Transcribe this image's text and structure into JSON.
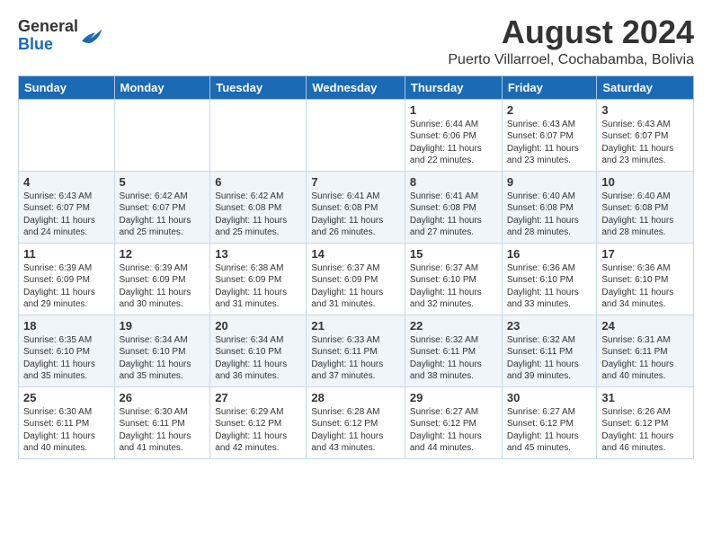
{
  "logo": {
    "general": "General",
    "blue": "Blue"
  },
  "title": "August 2024",
  "subtitle": "Puerto Villarroel, Cochabamba, Bolivia",
  "days_header": [
    "Sunday",
    "Monday",
    "Tuesday",
    "Wednesday",
    "Thursday",
    "Friday",
    "Saturday"
  ],
  "weeks": [
    [
      {
        "day": "",
        "info": ""
      },
      {
        "day": "",
        "info": ""
      },
      {
        "day": "",
        "info": ""
      },
      {
        "day": "",
        "info": ""
      },
      {
        "day": "1",
        "info": "Sunrise: 6:44 AM\nSunset: 6:06 PM\nDaylight: 11 hours\nand 22 minutes."
      },
      {
        "day": "2",
        "info": "Sunrise: 6:43 AM\nSunset: 6:07 PM\nDaylight: 11 hours\nand 23 minutes."
      },
      {
        "day": "3",
        "info": "Sunrise: 6:43 AM\nSunset: 6:07 PM\nDaylight: 11 hours\nand 23 minutes."
      }
    ],
    [
      {
        "day": "4",
        "info": "Sunrise: 6:43 AM\nSunset: 6:07 PM\nDaylight: 11 hours\nand 24 minutes."
      },
      {
        "day": "5",
        "info": "Sunrise: 6:42 AM\nSunset: 6:07 PM\nDaylight: 11 hours\nand 25 minutes."
      },
      {
        "day": "6",
        "info": "Sunrise: 6:42 AM\nSunset: 6:08 PM\nDaylight: 11 hours\nand 25 minutes."
      },
      {
        "day": "7",
        "info": "Sunrise: 6:41 AM\nSunset: 6:08 PM\nDaylight: 11 hours\nand 26 minutes."
      },
      {
        "day": "8",
        "info": "Sunrise: 6:41 AM\nSunset: 6:08 PM\nDaylight: 11 hours\nand 27 minutes."
      },
      {
        "day": "9",
        "info": "Sunrise: 6:40 AM\nSunset: 6:08 PM\nDaylight: 11 hours\nand 28 minutes."
      },
      {
        "day": "10",
        "info": "Sunrise: 6:40 AM\nSunset: 6:08 PM\nDaylight: 11 hours\nand 28 minutes."
      }
    ],
    [
      {
        "day": "11",
        "info": "Sunrise: 6:39 AM\nSunset: 6:09 PM\nDaylight: 11 hours\nand 29 minutes."
      },
      {
        "day": "12",
        "info": "Sunrise: 6:39 AM\nSunset: 6:09 PM\nDaylight: 11 hours\nand 30 minutes."
      },
      {
        "day": "13",
        "info": "Sunrise: 6:38 AM\nSunset: 6:09 PM\nDaylight: 11 hours\nand 31 minutes."
      },
      {
        "day": "14",
        "info": "Sunrise: 6:37 AM\nSunset: 6:09 PM\nDaylight: 11 hours\nand 31 minutes."
      },
      {
        "day": "15",
        "info": "Sunrise: 6:37 AM\nSunset: 6:10 PM\nDaylight: 11 hours\nand 32 minutes."
      },
      {
        "day": "16",
        "info": "Sunrise: 6:36 AM\nSunset: 6:10 PM\nDaylight: 11 hours\nand 33 minutes."
      },
      {
        "day": "17",
        "info": "Sunrise: 6:36 AM\nSunset: 6:10 PM\nDaylight: 11 hours\nand 34 minutes."
      }
    ],
    [
      {
        "day": "18",
        "info": "Sunrise: 6:35 AM\nSunset: 6:10 PM\nDaylight: 11 hours\nand 35 minutes."
      },
      {
        "day": "19",
        "info": "Sunrise: 6:34 AM\nSunset: 6:10 PM\nDaylight: 11 hours\nand 35 minutes."
      },
      {
        "day": "20",
        "info": "Sunrise: 6:34 AM\nSunset: 6:10 PM\nDaylight: 11 hours\nand 36 minutes."
      },
      {
        "day": "21",
        "info": "Sunrise: 6:33 AM\nSunset: 6:11 PM\nDaylight: 11 hours\nand 37 minutes."
      },
      {
        "day": "22",
        "info": "Sunrise: 6:32 AM\nSunset: 6:11 PM\nDaylight: 11 hours\nand 38 minutes."
      },
      {
        "day": "23",
        "info": "Sunrise: 6:32 AM\nSunset: 6:11 PM\nDaylight: 11 hours\nand 39 minutes."
      },
      {
        "day": "24",
        "info": "Sunrise: 6:31 AM\nSunset: 6:11 PM\nDaylight: 11 hours\nand 40 minutes."
      }
    ],
    [
      {
        "day": "25",
        "info": "Sunrise: 6:30 AM\nSunset: 6:11 PM\nDaylight: 11 hours\nand 40 minutes."
      },
      {
        "day": "26",
        "info": "Sunrise: 6:30 AM\nSunset: 6:11 PM\nDaylight: 11 hours\nand 41 minutes."
      },
      {
        "day": "27",
        "info": "Sunrise: 6:29 AM\nSunset: 6:12 PM\nDaylight: 11 hours\nand 42 minutes."
      },
      {
        "day": "28",
        "info": "Sunrise: 6:28 AM\nSunset: 6:12 PM\nDaylight: 11 hours\nand 43 minutes."
      },
      {
        "day": "29",
        "info": "Sunrise: 6:27 AM\nSunset: 6:12 PM\nDaylight: 11 hours\nand 44 minutes."
      },
      {
        "day": "30",
        "info": "Sunrise: 6:27 AM\nSunset: 6:12 PM\nDaylight: 11 hours\nand 45 minutes."
      },
      {
        "day": "31",
        "info": "Sunrise: 6:26 AM\nSunset: 6:12 PM\nDaylight: 11 hours\nand 46 minutes."
      }
    ]
  ]
}
